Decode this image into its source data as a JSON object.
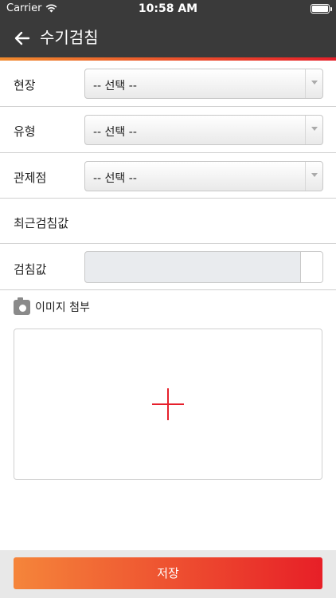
{
  "status_bar": {
    "carrier": "Carrier",
    "time": "10:58 AM"
  },
  "nav": {
    "title": "수기검침",
    "back_icon": "arrow-left-icon"
  },
  "form": {
    "site": {
      "label": "현장",
      "selected": "-- 선택 --"
    },
    "type": {
      "label": "유형",
      "selected": "-- 선택 --"
    },
    "control_point": {
      "label": "관제점",
      "selected": "-- 선택 --"
    },
    "recent_value": {
      "label": "최근검침값",
      "value": ""
    },
    "reading_value": {
      "label": "검침값",
      "value": ""
    },
    "attach": {
      "label": "이미지 첨부",
      "icon": "camera-icon",
      "add_icon": "plus-icon"
    }
  },
  "actions": {
    "save_label": "저장"
  },
  "colors": {
    "nav_bg": "#3a3a3a",
    "accent_start": "#f5853a",
    "accent_end": "#e71f27",
    "plus": "#e61f2b"
  }
}
